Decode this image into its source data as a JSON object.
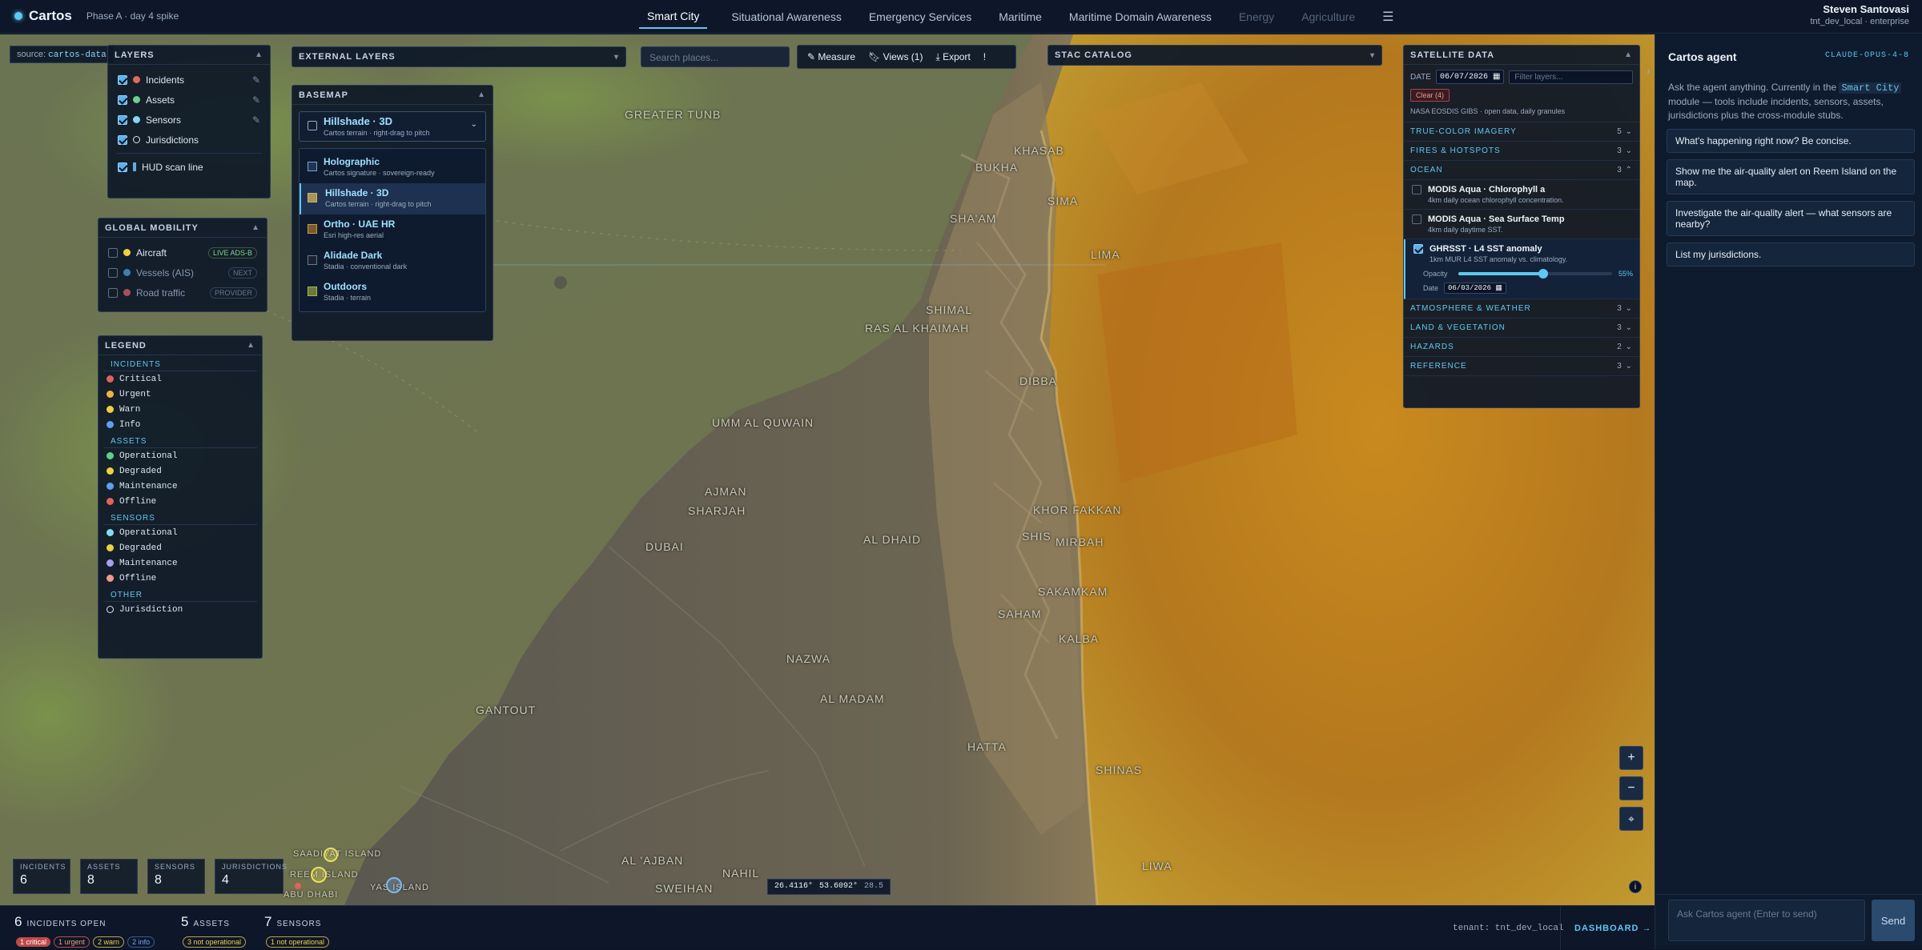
{
  "app": {
    "name": "Cartos",
    "subtitle": "Phase A · day 4 spike"
  },
  "nav": {
    "tabs": [
      "Smart City",
      "Situational Awareness",
      "Emergency Services",
      "Maritime",
      "Maritime Domain Awareness",
      "Energy",
      "Agriculture"
    ],
    "active": "Smart City"
  },
  "user": {
    "name": "Steven Santovasi",
    "meta": "tnt_dev_local · enterprise"
  },
  "source_tag": {
    "label": "source:",
    "value": "cartos-data"
  },
  "layers": {
    "title": "LAYERS",
    "items": [
      {
        "label": "Incidents",
        "color": "#e06a5a"
      },
      {
        "label": "Assets",
        "color": "#6fd08a"
      },
      {
        "label": "Sensors",
        "color": "#7fd8f0"
      },
      {
        "label": "Jurisdictions",
        "color": "hollow"
      },
      {
        "label": "HUD scan line",
        "color": "#6aa8e0"
      }
    ]
  },
  "external_layers": {
    "title": "EXTERNAL LAYERS"
  },
  "basemap": {
    "title": "BASEMAP",
    "selected": {
      "name": "Hillshade · 3D",
      "desc": "Cartos terrain · right-drag to pitch"
    },
    "options": [
      {
        "name": "Holographic",
        "desc": "Cartos signature · sovereign-ready"
      },
      {
        "name": "Hillshade · 3D",
        "desc": "Cartos terrain · right-drag to pitch"
      },
      {
        "name": "Ortho · UAE HR",
        "desc": "Esri high-res aerial"
      },
      {
        "name": "Alidade Dark",
        "desc": "Stadia · conventional dark"
      },
      {
        "name": "Outdoors",
        "desc": "Stadia · terrain"
      }
    ]
  },
  "search": {
    "placeholder": "Search places..."
  },
  "toolbar": {
    "measure": "Measure",
    "views": "Views (1)",
    "export": "Export",
    "more": "!"
  },
  "stac": {
    "title": "STAC CATALOG"
  },
  "mobility": {
    "title": "GLOBAL MOBILITY",
    "items": [
      {
        "label": "Aircraft",
        "badge": "LIVE ADS-B"
      },
      {
        "label": "Vessels (AIS)",
        "badge": "NEXT"
      },
      {
        "label": "Road traffic",
        "badge": "PROVIDER"
      }
    ]
  },
  "legend": {
    "title": "LEGEND",
    "sections": [
      {
        "name": "INCIDENTS",
        "items": [
          [
            "Critical",
            "#e0625c"
          ],
          [
            "Urgent",
            "#f0b43c"
          ],
          [
            "Warn",
            "#f0d040"
          ],
          [
            "Info",
            "#5e9ff0"
          ]
        ]
      },
      {
        "name": "ASSETS",
        "items": [
          [
            "Operational",
            "#5ed08a"
          ],
          [
            "Degraded",
            "#f0d040"
          ],
          [
            "Maintenance",
            "#5e9ff0"
          ],
          [
            "Offline",
            "#e0625c"
          ]
        ]
      },
      {
        "name": "SENSORS",
        "items": [
          [
            "Operational",
            "#7fe0f0"
          ],
          [
            "Degraded",
            "#f0d040"
          ],
          [
            "Maintenance",
            "#a89ff0"
          ],
          [
            "Offline",
            "#f09a8a"
          ]
        ]
      },
      {
        "name": "OTHER",
        "items": [
          [
            "Jurisdiction",
            "hollow"
          ]
        ]
      }
    ]
  },
  "satellite": {
    "title": "SATELLITE DATA",
    "date_label": "DATE",
    "date_value": "06/07/2026",
    "filter_placeholder": "Filter layers...",
    "clear": "Clear (4)",
    "source_note": "NASA EOSDIS GIBS · open data, daily granules",
    "categories_top": [
      {
        "name": "TRUE-COLOR IMAGERY",
        "count": "5"
      },
      {
        "name": "FIRES & HOTSPOTS",
        "count": "3"
      },
      {
        "name": "OCEAN",
        "count": "3"
      }
    ],
    "ocean_items": [
      {
        "name": "MODIS Aqua · Chlorophyll a",
        "desc": "4km daily ocean chlorophyll concentration."
      },
      {
        "name": "MODIS Aqua · Sea Surface Temp",
        "desc": "4km daily daytime SST."
      },
      {
        "name": "GHRSST · L4 SST anomaly",
        "desc": "1km MUR L4 SST anomaly vs. climatology."
      }
    ],
    "opacity_label": "Opacity",
    "opacity_value": "55%",
    "opacity_fraction": 0.55,
    "item_date_label": "Date",
    "item_date_value": "06/03/2026",
    "categories_bottom": [
      {
        "name": "ATMOSPHERE & WEATHER",
        "count": "3"
      },
      {
        "name": "LAND & VEGETATION",
        "count": "3"
      },
      {
        "name": "HAZARDS",
        "count": "2"
      },
      {
        "name": "REFERENCE",
        "count": "3"
      }
    ]
  },
  "places": [
    "GREATER TUNB",
    "KHASAB",
    "BUKHA",
    "SIMA",
    "SHA'AM",
    "LIMA",
    "SHIMAL",
    "RAS AL KHAIMAH",
    "DIBBA",
    "UMM AL QUWAIN",
    "AJMAN",
    "SHARJAH",
    "DUBAI",
    "AL DHAID",
    "KHOR FAKKAN",
    "SHIS",
    "MIRBAH",
    "SAKAMKAM",
    "SAHAM",
    "KALBA",
    "NAZWA",
    "AL MADAM",
    "GANTOUT",
    "HATTA",
    "SHINAS",
    "AL 'AJBAN",
    "NAHIL",
    "SWEIHAN",
    "LIWA",
    "YAS ISLAND",
    "SAADIYAT ISLAND",
    "REEM ISLAND",
    "ABU DHABI"
  ],
  "coords": {
    "lat": "26.4116°",
    "lon": "53.6092°",
    "zoom": "28.5"
  },
  "stats": [
    {
      "label": "INCIDENTS",
      "value": "6"
    },
    {
      "label": "ASSETS",
      "value": "8"
    },
    {
      "label": "SENSORS",
      "value": "8"
    },
    {
      "label": "JURISDICTIONS",
      "value": "4"
    }
  ],
  "bottom": {
    "incidents_count": "6",
    "incidents_label": "INCIDENTS OPEN",
    "chips": [
      "1 critical",
      "1 urgent",
      "2 warn",
      "2 info"
    ],
    "assets_count": "5",
    "assets_label": "ASSETS",
    "assets_chip": "3 not operational",
    "sensors_count": "7",
    "sensors_label": "SENSORS",
    "sensors_chip": "1 not operational",
    "tenant": "tenant: tnt_dev_local",
    "dashboard": "DASHBOARD →"
  },
  "agent": {
    "title": "Cartos agent",
    "model": "CLAUDE-OPUS-4-8",
    "intro_before": "Ask the agent anything. Currently in the",
    "intro_module": "Smart City",
    "intro_after": "module — tools include incidents, sensors, assets, jurisdictions plus the cross-module stubs.",
    "prompts": [
      "What's happening right now? Be concise.",
      "Show me the air-quality alert on Reem Island on the map.",
      "Investigate the air-quality alert — what sensors are nearby?",
      "List my jurisdictions."
    ],
    "input_placeholder": "Ask Cartos agent (Enter to send)",
    "send": "Send"
  }
}
